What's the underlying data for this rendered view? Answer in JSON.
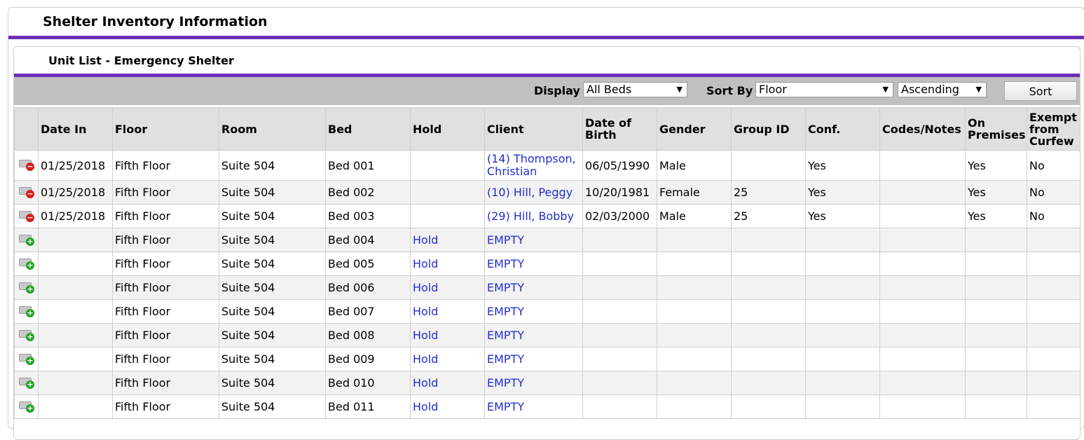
{
  "page": {
    "title": "Shelter Inventory Information",
    "subtitle": "Unit List - Emergency Shelter"
  },
  "toolbar": {
    "display_label": "Display",
    "display_value": "All Beds",
    "sortby_label": "Sort By",
    "sortby_value": "Floor",
    "order_value": "Ascending",
    "sort_button": "Sort"
  },
  "colors": {
    "accent": "#6b2fb3",
    "link": "#1f2fd1"
  },
  "table": {
    "headers": [
      "",
      "Date In",
      "Floor",
      "Room",
      "Bed",
      "Hold",
      "Client",
      "Date of Birth",
      "Gender",
      "Group ID",
      "Conf.",
      "Codes/Notes",
      "On Premises",
      "Exempt from Curfew"
    ],
    "rows": [
      {
        "icon": "bed-remove-icon",
        "date_in": "01/25/2018",
        "floor": "Fifth Floor",
        "room": "Suite 504",
        "bed": "Bed 001",
        "hold": "",
        "client": "(14) Thompson, Christian",
        "dob": "06/05/1990",
        "gender": "Male",
        "group_id": "",
        "conf": "Yes",
        "codes": "",
        "on_premises": "Yes",
        "exempt": "No"
      },
      {
        "icon": "bed-remove-icon",
        "date_in": "01/25/2018",
        "floor": "Fifth Floor",
        "room": "Suite 504",
        "bed": "Bed 002",
        "hold": "",
        "client": "(10) Hill, Peggy",
        "dob": "10/20/1981",
        "gender": "Female",
        "group_id": "25",
        "conf": "Yes",
        "codes": "",
        "on_premises": "Yes",
        "exempt": "No"
      },
      {
        "icon": "bed-remove-icon",
        "date_in": "01/25/2018",
        "floor": "Fifth Floor",
        "room": "Suite 504",
        "bed": "Bed 003",
        "hold": "",
        "client": "(29) Hill, Bobby",
        "dob": "02/03/2000",
        "gender": "Male",
        "group_id": "25",
        "conf": "Yes",
        "codes": "",
        "on_premises": "Yes",
        "exempt": "No"
      },
      {
        "icon": "bed-add-icon",
        "date_in": "",
        "floor": "Fifth Floor",
        "room": "Suite 504",
        "bed": "Bed 004",
        "hold": "Hold",
        "client": "EMPTY",
        "dob": "",
        "gender": "",
        "group_id": "",
        "conf": "",
        "codes": "",
        "on_premises": "",
        "exempt": ""
      },
      {
        "icon": "bed-add-icon",
        "date_in": "",
        "floor": "Fifth Floor",
        "room": "Suite 504",
        "bed": "Bed 005",
        "hold": "Hold",
        "client": "EMPTY",
        "dob": "",
        "gender": "",
        "group_id": "",
        "conf": "",
        "codes": "",
        "on_premises": "",
        "exempt": ""
      },
      {
        "icon": "bed-add-icon",
        "date_in": "",
        "floor": "Fifth Floor",
        "room": "Suite 504",
        "bed": "Bed 006",
        "hold": "Hold",
        "client": "EMPTY",
        "dob": "",
        "gender": "",
        "group_id": "",
        "conf": "",
        "codes": "",
        "on_premises": "",
        "exempt": ""
      },
      {
        "icon": "bed-add-icon",
        "date_in": "",
        "floor": "Fifth Floor",
        "room": "Suite 504",
        "bed": "Bed 007",
        "hold": "Hold",
        "client": "EMPTY",
        "dob": "",
        "gender": "",
        "group_id": "",
        "conf": "",
        "codes": "",
        "on_premises": "",
        "exempt": ""
      },
      {
        "icon": "bed-add-icon",
        "date_in": "",
        "floor": "Fifth Floor",
        "room": "Suite 504",
        "bed": "Bed 008",
        "hold": "Hold",
        "client": "EMPTY",
        "dob": "",
        "gender": "",
        "group_id": "",
        "conf": "",
        "codes": "",
        "on_premises": "",
        "exempt": ""
      },
      {
        "icon": "bed-add-icon",
        "date_in": "",
        "floor": "Fifth Floor",
        "room": "Suite 504",
        "bed": "Bed 009",
        "hold": "Hold",
        "client": "EMPTY",
        "dob": "",
        "gender": "",
        "group_id": "",
        "conf": "",
        "codes": "",
        "on_premises": "",
        "exempt": ""
      },
      {
        "icon": "bed-add-icon",
        "date_in": "",
        "floor": "Fifth Floor",
        "room": "Suite 504",
        "bed": "Bed 010",
        "hold": "Hold",
        "client": "EMPTY",
        "dob": "",
        "gender": "",
        "group_id": "",
        "conf": "",
        "codes": "",
        "on_premises": "",
        "exempt": ""
      },
      {
        "icon": "bed-add-icon",
        "date_in": "",
        "floor": "Fifth Floor",
        "room": "Suite 504",
        "bed": "Bed 011",
        "hold": "Hold",
        "client": "EMPTY",
        "dob": "",
        "gender": "",
        "group_id": "",
        "conf": "",
        "codes": "",
        "on_premises": "",
        "exempt": ""
      }
    ]
  }
}
